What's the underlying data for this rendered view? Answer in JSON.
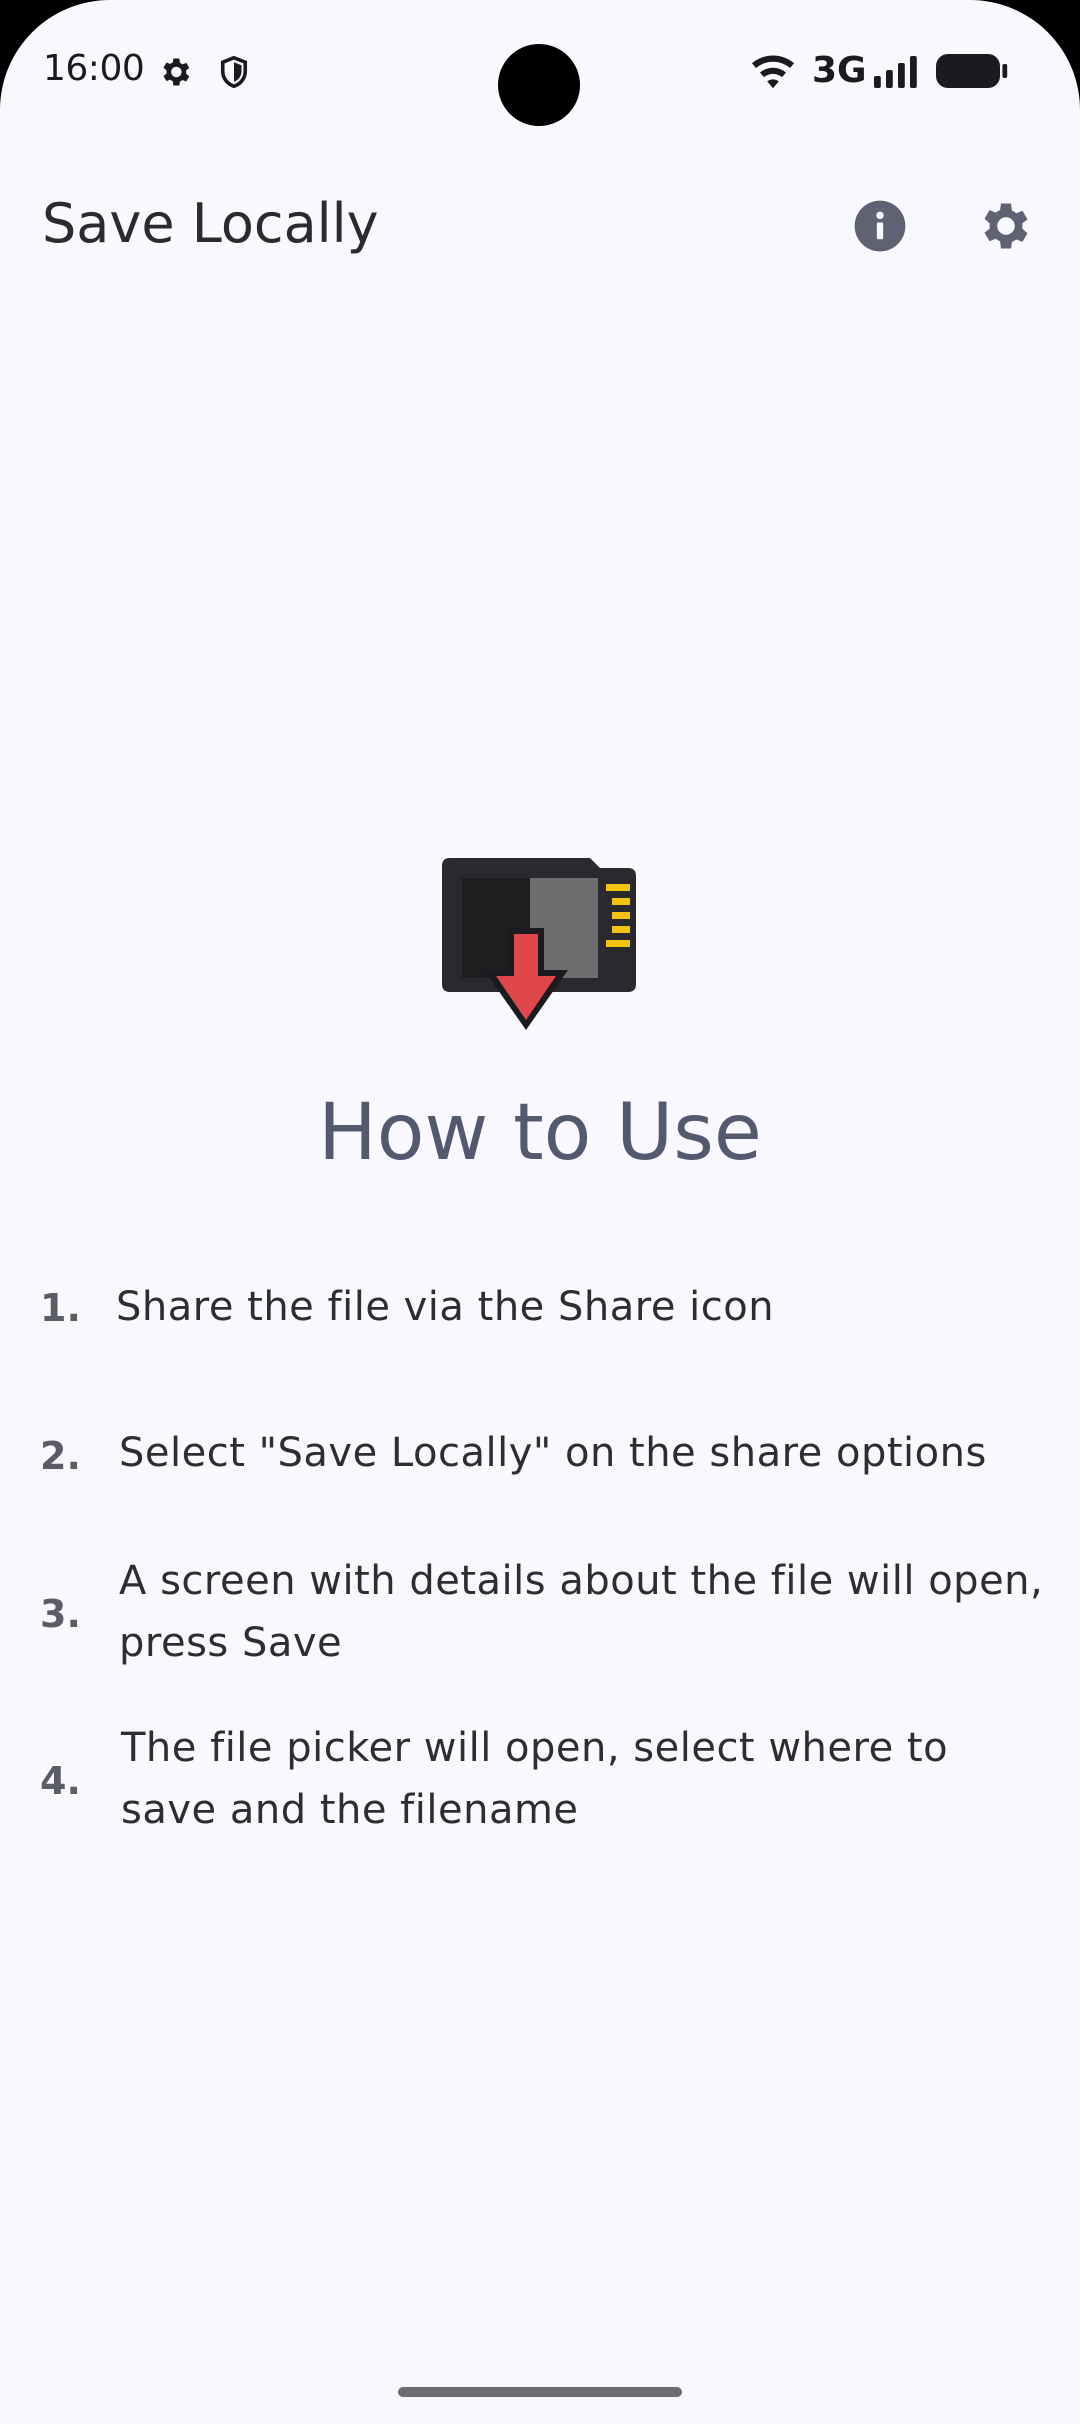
{
  "status_bar": {
    "time": "16:00",
    "network": "3G",
    "icons": [
      "settings-gear-icon",
      "shield-icon",
      "wifi-icon",
      "cellular-signal-icon",
      "battery-icon"
    ]
  },
  "app_bar": {
    "title": "Save Locally",
    "actions": [
      "info-icon",
      "settings-icon"
    ]
  },
  "main": {
    "hero_icon": "sd-card-download-icon",
    "heading": "How to Use",
    "steps": [
      {
        "number": "1.",
        "text": "Share the file via the Share icon"
      },
      {
        "number": "2.",
        "text": "Select \"Save Locally\" on the share options"
      },
      {
        "number": "3.",
        "text_line1": "A screen with details about the file will open,",
        "text_line2": "press Save"
      },
      {
        "number": "4.",
        "text_line1": "The file picker will open, select where to",
        "text_line2": "save and the filename"
      }
    ]
  },
  "colors": {
    "background": "#FAF8FF",
    "heading": "#535A70",
    "icon_gray": "#5F6272",
    "accent_red": "#E0474C",
    "accent_yellow": "#F2C40F"
  }
}
